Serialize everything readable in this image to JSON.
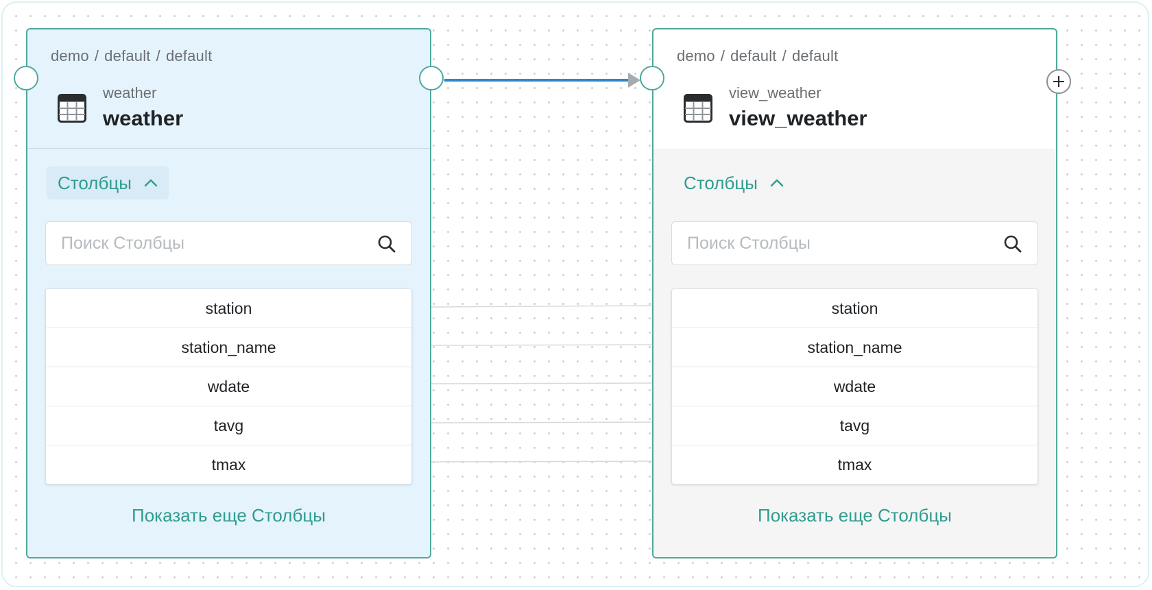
{
  "colors": {
    "accent": "#2f9c8f",
    "node_border": "#4fa89d",
    "edge": "#2f86c6",
    "source_bg": "#e5f3fc",
    "target_bg": "#f5f5f5"
  },
  "source_node": {
    "breadcrumb": [
      "demo",
      "default",
      "default"
    ],
    "subtitle": "weather",
    "title": "weather",
    "icon": "table-icon",
    "columns_label": "Столбцы",
    "search_placeholder": "Поиск Столбцы",
    "columns": [
      "station",
      "station_name",
      "wdate",
      "tavg",
      "tmax"
    ],
    "show_more": "Показать еще Столбцы"
  },
  "target_node": {
    "breadcrumb": [
      "demo",
      "default",
      "default"
    ],
    "subtitle": "view_weather",
    "title": "view_weather",
    "icon": "table-icon",
    "columns_label": "Столбцы",
    "search_placeholder": "Поиск Столбцы",
    "columns": [
      "station",
      "station_name",
      "wdate",
      "tavg",
      "tmax"
    ],
    "show_more": "Показать еще Столбцы"
  }
}
